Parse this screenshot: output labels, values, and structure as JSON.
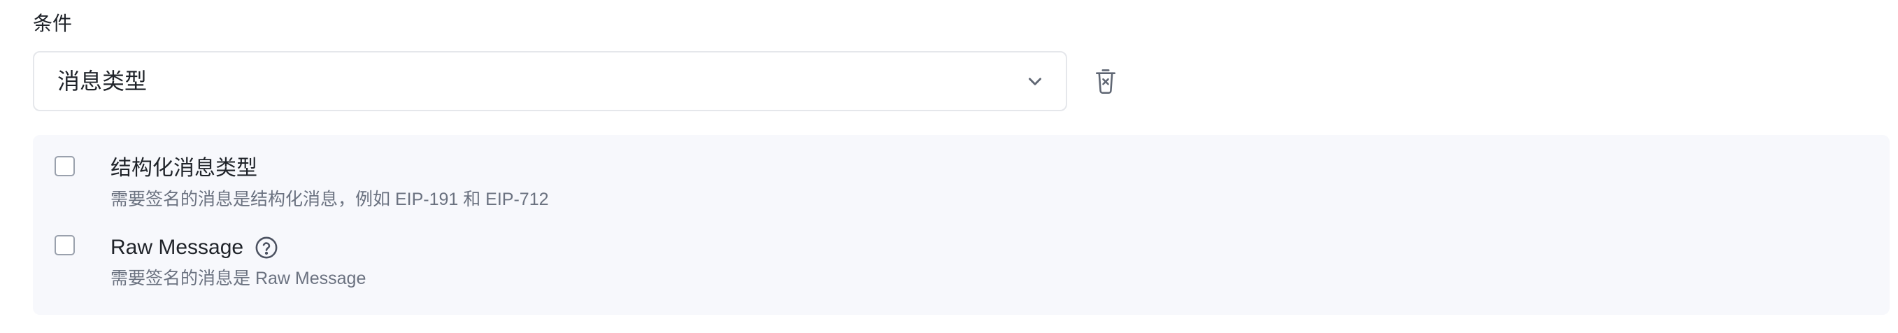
{
  "condition": {
    "label": "条件",
    "selected_value": "消息类型"
  },
  "icons": {
    "dropdown": "chevron-down-icon",
    "delete": "trash-icon",
    "help": "question-circle-icon"
  },
  "options": [
    {
      "title": "结构化消息类型",
      "description": "需要签名的消息是结构化消息，例如 EIP-191 和 EIP-712",
      "checked": false
    },
    {
      "title": "Raw Message",
      "description": "需要签名的消息是 Raw Message",
      "checked": false
    }
  ],
  "colors": {
    "panel_background": "#f7f8fc",
    "border": "#e5e7eb",
    "muted_text": "#6b7280"
  }
}
